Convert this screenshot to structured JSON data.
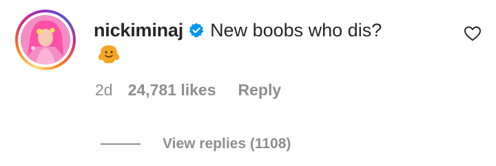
{
  "comment": {
    "username": "nickiminaj",
    "text": "New boobs who dis?",
    "emoji_icon": "smiling-blob-emoji",
    "time": "2d",
    "likes": "24,781 likes",
    "reply_label": "Reply",
    "view_replies": "View replies (1108)",
    "verified_icon": "verified-badge-icon",
    "like_icon": "heart-outline-icon",
    "colors": {
      "text": "#262626",
      "secondary": "#8e8e8e",
      "verified": "#0095f6",
      "emoji": "#f6a623"
    }
  }
}
